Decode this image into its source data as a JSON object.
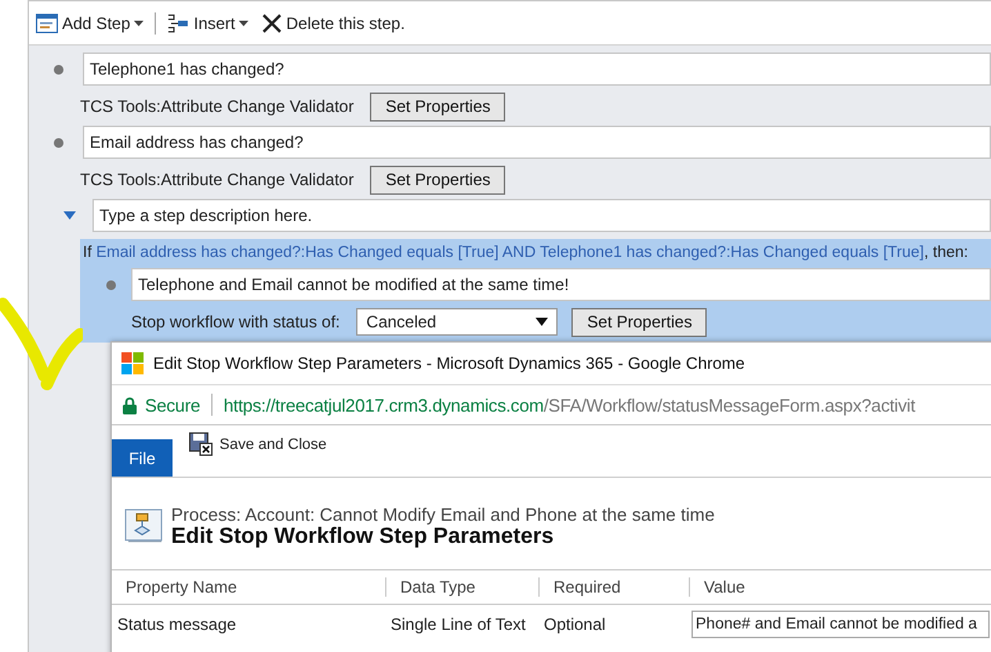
{
  "toolbar": {
    "items": [
      {
        "label": "Add Step",
        "kind": "add"
      },
      {
        "label": "Insert",
        "kind": "insert"
      },
      {
        "label": "Delete this step.",
        "kind": "delete"
      }
    ]
  },
  "steps": [
    {
      "description": "Telephone1 has changed?",
      "activity": "TCS Tools:Attribute Change Validator",
      "button": "Set Properties"
    },
    {
      "description": "Email address has changed?",
      "activity": "TCS Tools:Attribute Change Validator",
      "button": "Set Properties"
    }
  ],
  "condition_step": {
    "placeholder": "Type a step description here.",
    "expanded": true,
    "condition": {
      "prefix": "If",
      "link": "Email address has changed?:Has Changed equals [True] AND Telephone1 has changed?:Has Changed equals [True]",
      "suffix": ", then:"
    },
    "action": {
      "description": "Telephone and Email cannot be modified at the same time!",
      "label": "Stop workflow with status of:",
      "status": "Canceled",
      "button": "Set Properties"
    }
  },
  "dialog": {
    "window_title": "Edit Stop Workflow Step Parameters - Microsoft Dynamics 365 - Google Chrome",
    "secure_label": "Secure",
    "url_host": "https://treecatjul2017.crm3.dynamics.com",
    "url_path": "/SFA/Workflow/statusMessageForm.aspx?activit",
    "file_tab": "File",
    "save_button": "Save and Close",
    "process": "Process: Account: Cannot Modify Email and Phone at the same time",
    "title": "Edit Stop Workflow Step Parameters",
    "table": {
      "columns": [
        "Property Name",
        "Data Type",
        "Required",
        "Value"
      ],
      "rows": [
        {
          "name": "Status message",
          "type": "Single Line of Text",
          "required": "Optional",
          "value": "Phone# and Email cannot be modified a"
        }
      ]
    }
  }
}
